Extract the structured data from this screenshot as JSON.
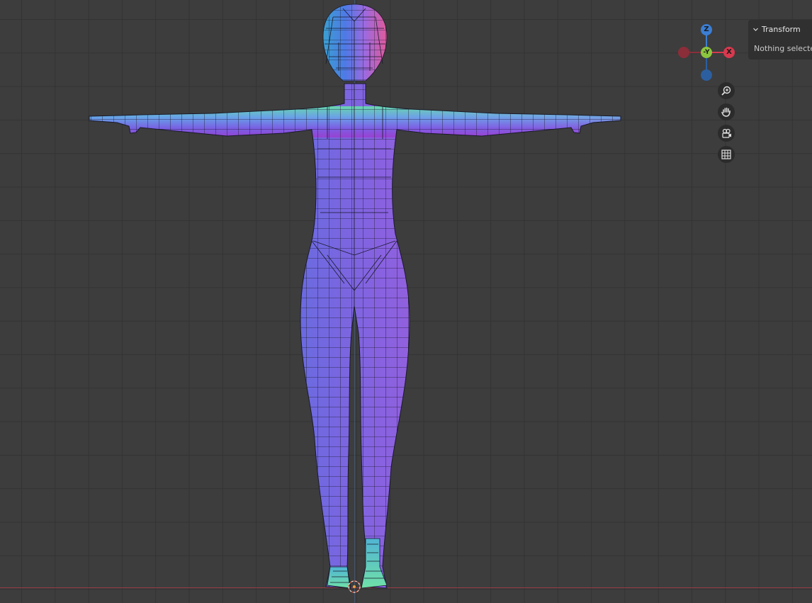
{
  "sidebar": {
    "panel_title": "Transform",
    "empty_message": "Nothing selecte"
  },
  "gizmo": {
    "z_label": "Z",
    "y_label": "-Y",
    "x_label": "X",
    "x_color": "#d8394e",
    "y_color": "#8cc63f",
    "z_color": "#3b7ed4",
    "neg_x_color": "#8c2d3a",
    "neg_z_color": "#2c5fa0"
  },
  "nav_buttons": [
    "zoom-icon",
    "hand-pan-icon",
    "camera-icon",
    "grid-icon"
  ],
  "viewport": {
    "background": "#3d3d3d",
    "grid_color": "#333333",
    "x_axis_color": "#9a3b44"
  }
}
